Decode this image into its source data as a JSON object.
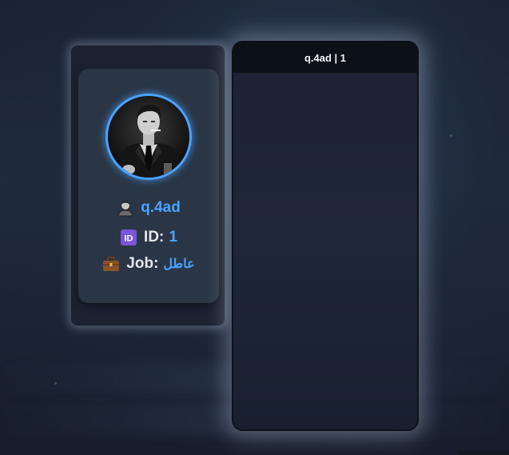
{
  "profile": {
    "name": "q.4ad",
    "id_label": "ID:",
    "id_value": "1",
    "job_label": "Job:",
    "job_value": "عاطل",
    "icons": {
      "name": "person-icon",
      "id": "id-badge-icon",
      "job": "briefcase-icon"
    },
    "avatar": "profile-avatar-photo"
  },
  "panel": {
    "title": "q.4ad | 1"
  },
  "colors": {
    "accent": "#4aa3ff",
    "card_bg": "#2a3645",
    "panel_header": "#0c1017"
  }
}
